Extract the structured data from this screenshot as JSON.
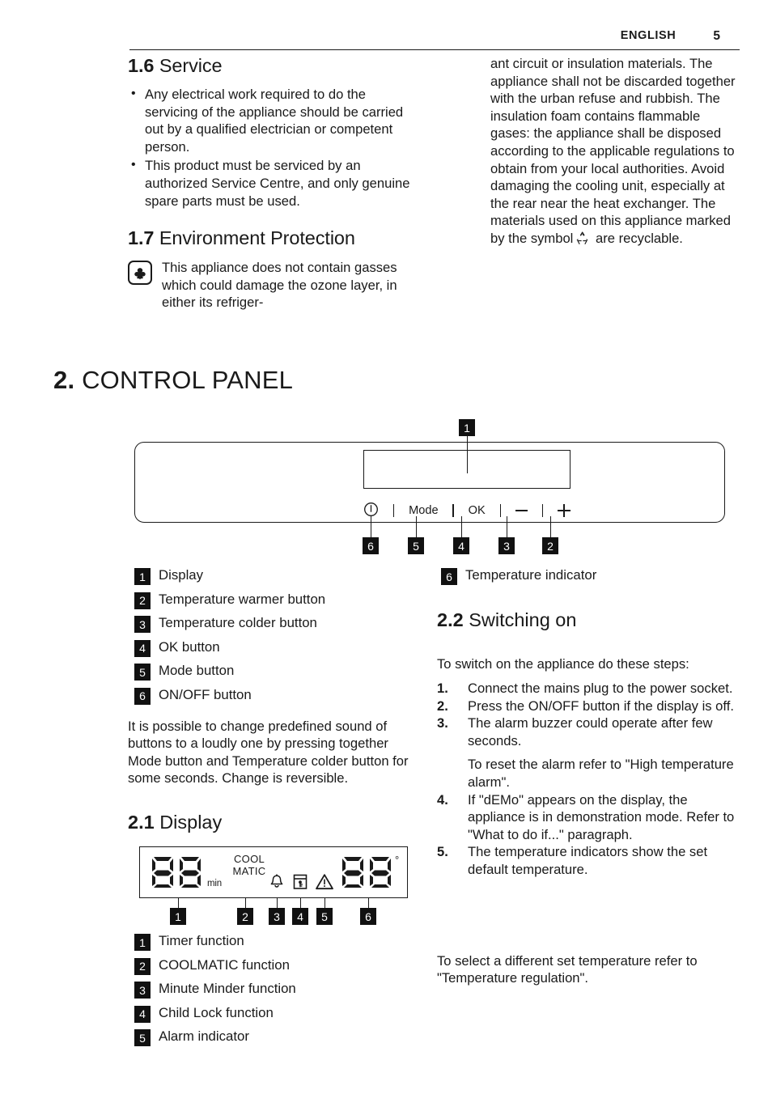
{
  "header": {
    "language": "ENGLISH",
    "page_number": "5"
  },
  "left_column": {
    "section_1_6": {
      "number": "1.6",
      "title": "Service",
      "bullets": [
        "Any electrical work required to do the servicing of the appliance should be carried out by a qualified electrician or competent person.",
        "This product must be serviced by an authorized Service Centre, and only genuine spare parts must be used."
      ]
    },
    "section_1_7": {
      "number": "1.7",
      "title": "Environment Protection",
      "icon": "flower-icon",
      "text": "This appliance does not contain gasses which could damage the ozone layer, in either its refriger-"
    }
  },
  "right_column_top": {
    "text_before_symbol": "ant circuit or insulation materials. The appliance shall not be discarded together with the urban refuse and rubbish. The insulation foam contains flammable gases: the appliance shall be disposed according to the applicable regulations to obtain from your local authorities. Avoid damaging the cooling unit, especially at the rear near the heat exchanger. The materials used on this appliance marked by the symbol",
    "symbol_icon": "recycle-icon",
    "text_after_symbol": "are recyclable."
  },
  "main_section": {
    "number": "2.",
    "title": "CONTROL PANEL"
  },
  "control_panel_figure": {
    "callout_top": "1",
    "buttons": [
      {
        "id": "power",
        "label": "",
        "icon": "power-icon",
        "callout": "6"
      },
      {
        "id": "mode",
        "label": "Mode",
        "icon": "",
        "callout": "5"
      },
      {
        "id": "ok",
        "label": "OK",
        "icon": "",
        "callout": "4"
      },
      {
        "id": "minus",
        "label": "",
        "icon": "minus-icon",
        "callout": "3"
      },
      {
        "id": "plus",
        "label": "",
        "icon": "plus-icon",
        "callout": "2"
      }
    ]
  },
  "control_panel_legend_left": [
    {
      "num": "1",
      "label": "Display"
    },
    {
      "num": "2",
      "label": "Temperature warmer button"
    },
    {
      "num": "3",
      "label": "Temperature colder button"
    },
    {
      "num": "4",
      "label": "OK button"
    },
    {
      "num": "5",
      "label": "Mode button"
    },
    {
      "num": "6",
      "label": "ON/OFF button"
    }
  ],
  "control_panel_legend_right": [
    {
      "num": "6",
      "label": "Temperature indicator"
    }
  ],
  "note_paragraph": "It is possible to change predefined sound of buttons to a loudly one by pressing together Mode button and Temperature colder button for some seconds. Change is reversible.",
  "section_2_1": {
    "number": "2.1",
    "title": "Display",
    "display_figure": {
      "left_digits": "88",
      "left_unit": "min",
      "coolmatic_line1": "COOL",
      "coolmatic_line2": "MATIC",
      "icons": [
        {
          "name": "bell-icon",
          "callout": "3"
        },
        {
          "name": "child-lock-icon",
          "callout": "4"
        },
        {
          "name": "warning-triangle-icon",
          "callout": "5"
        }
      ],
      "right_digits": "88",
      "degree_symbol": "°",
      "callouts": [
        "1",
        "2",
        "3",
        "4",
        "5",
        "6"
      ]
    },
    "legend": [
      {
        "num": "1",
        "label": "Timer function"
      },
      {
        "num": "2",
        "label": "COOLMATIC function"
      },
      {
        "num": "3",
        "label": "Minute Minder function"
      },
      {
        "num": "4",
        "label": "Child Lock function"
      },
      {
        "num": "5",
        "label": "Alarm indicator"
      }
    ]
  },
  "section_2_2": {
    "number": "2.2",
    "title": "Switching on",
    "intro": "To switch on the appliance do these steps:",
    "steps": [
      {
        "num": "1.",
        "text": "Connect the mains plug to the power socket."
      },
      {
        "num": "2.",
        "text": "Press the ON/OFF button if the display is off."
      },
      {
        "num": "3.",
        "text": "The alarm buzzer could operate after few seconds."
      },
      {
        "num": "4.",
        "text": "If \"dEMo\" appears on the display, the appliance is in demonstration mode. Refer to \"What to do if...\" paragraph."
      },
      {
        "num": "5.",
        "text": "The temperature indicators show the set default temperature."
      }
    ],
    "substep_after_3": "To reset the alarm refer to \"High temperature alarm\".",
    "outro": "To select a different set temperature refer to \"Temperature regulation\"."
  },
  "colors": {
    "ink": "#1a1a1a",
    "badge_bg": "#111111",
    "badge_fg": "#ffffff",
    "paper": "#ffffff"
  }
}
